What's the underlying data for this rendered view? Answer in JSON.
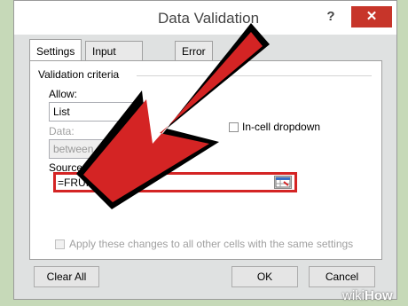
{
  "window": {
    "title": "Data Validation",
    "help_glyph": "?",
    "close_glyph": "✕"
  },
  "tabs": [
    {
      "label": "Settings",
      "active": true
    },
    {
      "label": "Input Message",
      "active": false
    },
    {
      "label": "Error Alert",
      "active": false
    }
  ],
  "settings": {
    "group_label": "Validation criteria",
    "allow_label": "Allow:",
    "allow_value": "List",
    "data_label": "Data:",
    "data_value": "between",
    "in_cell_dropdown_label": "In-cell dropdown",
    "source_label": "Source:",
    "source_value": "=FRUITS",
    "apply_all_label": "Apply these changes to all other cells with the same settings"
  },
  "buttons": {
    "clear_all": "Clear All",
    "ok": "OK",
    "cancel": "Cancel"
  },
  "watermark": {
    "brand_a": "wiki",
    "brand_b": "How"
  },
  "colors": {
    "arrow": "#d42424",
    "close_button": "#c7352a"
  }
}
